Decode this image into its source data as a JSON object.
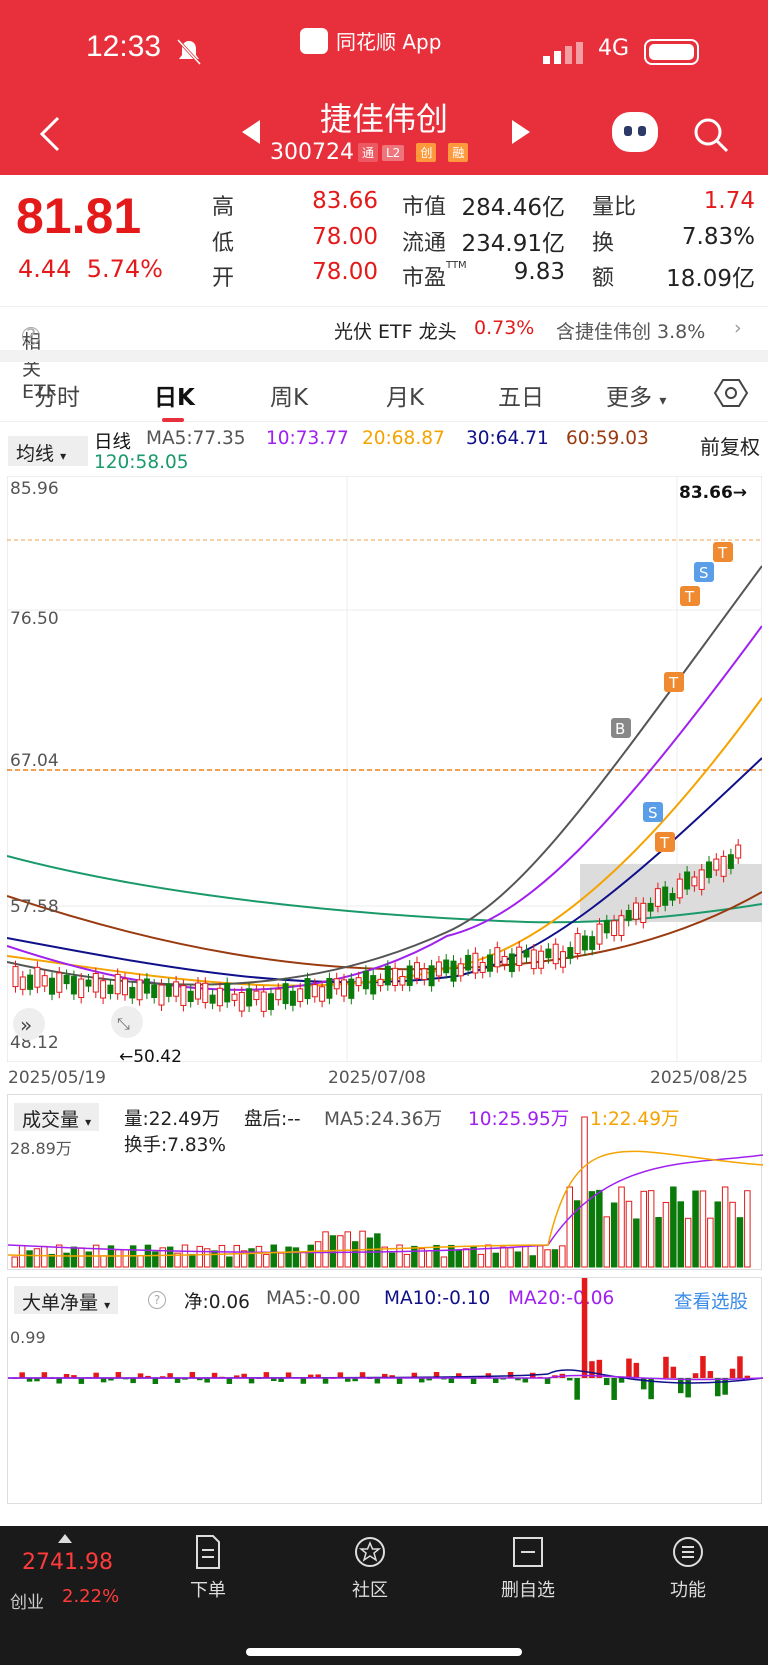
{
  "status_bar": {
    "time": "12:33",
    "app_name": "同花顺 App",
    "network": "4G"
  },
  "header": {
    "stock_name": "捷佳伟创",
    "stock_code": "300724",
    "tags": [
      "通",
      "L2",
      "创",
      "融"
    ]
  },
  "quote": {
    "price": "81.81",
    "change": "4.44",
    "change_pct": "5.74%",
    "high_label": "高",
    "high": "83.66",
    "low_label": "低",
    "low": "78.00",
    "open_label": "开",
    "open": "78.00",
    "mcap_label": "市值",
    "mcap": "284.46亿",
    "float_label": "流通",
    "float": "234.91亿",
    "pe_label": "市盈",
    "pe_sup": "TTM",
    "pe": "9.83",
    "vr_label": "量比",
    "vr": "1.74",
    "turn_label": "换",
    "turn": "7.83%",
    "amt_label": "额",
    "amt": "18.09亿"
  },
  "etf": {
    "label": "相关 ETF",
    "name": "光伏 ETF 龙头",
    "pct": "0.73%",
    "holding": "含捷佳伟创 3.8%"
  },
  "tabs": [
    "分时",
    "日K",
    "周K",
    "月K",
    "五日",
    "更多"
  ],
  "ma": {
    "select": "均线",
    "kind": "日线",
    "ma5": "MA5:77.35",
    "ma10": "10:73.77",
    "ma20": "20:68.87",
    "ma30": "30:64.71",
    "ma60": "60:59.03",
    "ma120": "120:58.05",
    "adjust": "前复权"
  },
  "kchart": {
    "y_labels": [
      "85.96",
      "76.50",
      "67.04",
      "57.58",
      "48.12"
    ],
    "high_marker": "83.66→",
    "low_marker": "←50.42",
    "dates": [
      "2025/05/19",
      "2025/07/08",
      "2025/08/25"
    ]
  },
  "volume": {
    "select": "成交量",
    "vol": "量:22.49万",
    "after": "盘后:--",
    "ma5": "MA5:24.36万",
    "ma10": "10:25.95万",
    "ma1": "1:22.49万",
    "turnover": "换手:7.83%",
    "y_label": "28.89万"
  },
  "flow": {
    "select": "大单净量",
    "net": "净:0.06",
    "ma5": "MA5:-0.00",
    "ma10": "MA10:-0.10",
    "ma20": "MA20:-0.06",
    "link": "查看选股",
    "y_label": "0.99"
  },
  "bottom": {
    "index_value": "2741.98",
    "index_name": "创业",
    "index_pct": "2.22%",
    "nav": [
      "下单",
      "社区",
      "删自选",
      "功能"
    ]
  },
  "colors": {
    "brand_red": "#e8303c",
    "up": "#e41a1a",
    "down": "#0a7a0a",
    "ma5": "#555555",
    "ma10": "#a020f0",
    "ma20": "#f4a300",
    "ma30": "#10108a",
    "ma60": "#9a3a10",
    "ma120": "#1a9a6a"
  }
}
